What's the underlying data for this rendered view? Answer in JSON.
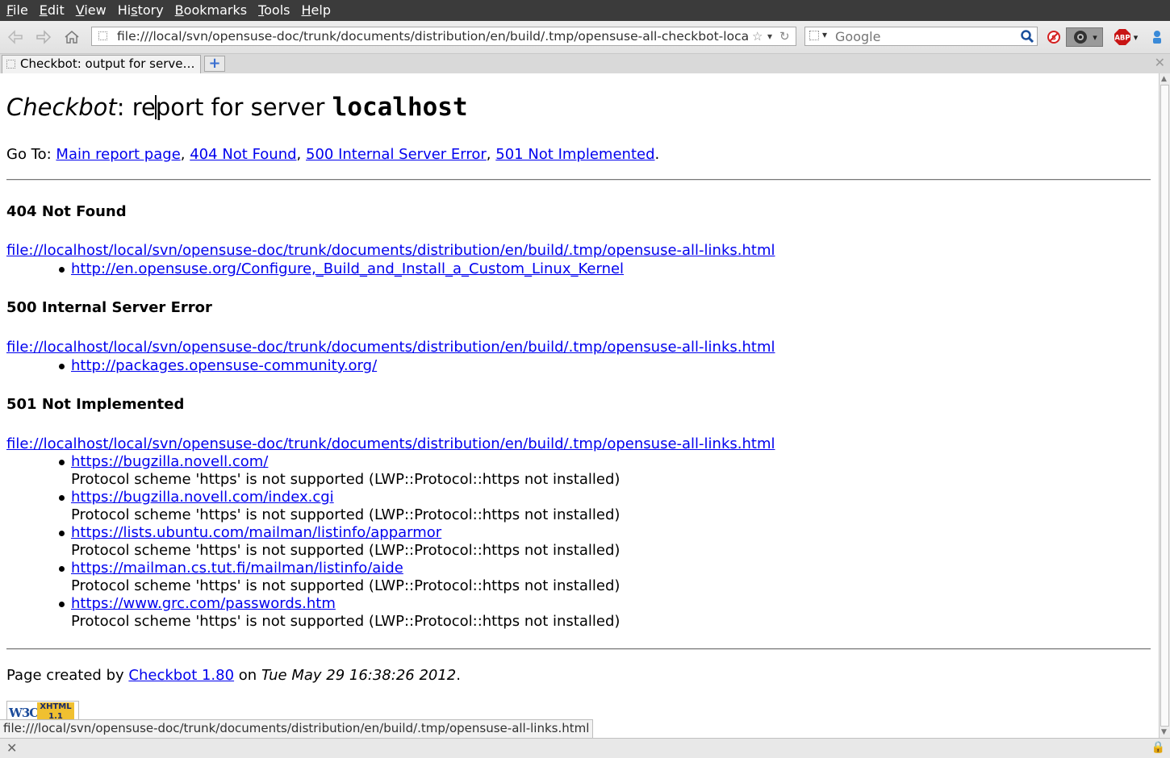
{
  "menubar": {
    "items": [
      {
        "u": "F",
        "rest": "ile"
      },
      {
        "u": "E",
        "rest": "dit"
      },
      {
        "u": "V",
        "rest": "iew"
      },
      {
        "u": "",
        "pre": "Hi",
        "u2": "s",
        "rest": "tory"
      },
      {
        "u": "B",
        "rest": "ookmarks"
      },
      {
        "u": "T",
        "rest": "ools"
      },
      {
        "u": "H",
        "rest": "elp"
      }
    ]
  },
  "navbar": {
    "url": "file:///local/svn/opensuse-doc/trunk/documents/distribution/en/build/.tmp/opensuse-all-checkbot-localhost.html",
    "search_placeholder": "Google",
    "icons": [
      "back-icon",
      "forward-icon",
      "home-icon",
      "bookmark-star-icon",
      "url-history-dropdown-icon",
      "reload-icon",
      "search-go-icon",
      "noscript-icon",
      "camera-icon",
      "adblock-plus-icon",
      "addon-person-icon"
    ],
    "abp_label": "ABP"
  },
  "tabs": [
    {
      "title": "Checkbot: output for server localhost",
      "active": true
    }
  ],
  "newtab_label": "+",
  "page": {
    "title_em": "Checkbot",
    "title_colon": ":",
    "title_part1": " re",
    "title_part2": "port for server ",
    "title_server": "localhost",
    "goto_label": "Go To: ",
    "goto_links": [
      "Main report page",
      "404 Not Found",
      "500 Internal Server Error",
      "501 Not Implemented"
    ],
    "goto_sep": ", ",
    "goto_end": ".",
    "sections": [
      {
        "heading": "404 Not Found",
        "source": "file://localhost/local/svn/opensuse-doc/trunk/documents/distribution/en/build/.tmp/opensuse-all-links.html",
        "items": [
          {
            "link": "http://en.opensuse.org/Configure,_Build_and_Install_a_Custom_Linux_Kernel",
            "msg": ""
          }
        ]
      },
      {
        "heading": "500 Internal Server Error",
        "source": "file://localhost/local/svn/opensuse-doc/trunk/documents/distribution/en/build/.tmp/opensuse-all-links.html",
        "items": [
          {
            "link": "http://packages.opensuse-community.org/",
            "msg": ""
          }
        ]
      },
      {
        "heading": "501 Not Implemented",
        "source": "file://localhost/local/svn/opensuse-doc/trunk/documents/distribution/en/build/.tmp/opensuse-all-links.html",
        "items": [
          {
            "link": "https://bugzilla.novell.com/",
            "msg": "Protocol scheme 'https' is not supported (LWP::Protocol::https not installed)"
          },
          {
            "link": "https://bugzilla.novell.com/index.cgi",
            "msg": "Protocol scheme 'https' is not supported (LWP::Protocol::https not installed)"
          },
          {
            "link": "https://lists.ubuntu.com/mailman/listinfo/apparmor",
            "msg": "Protocol scheme 'https' is not supported (LWP::Protocol::https not installed)"
          },
          {
            "link": "https://mailman.cs.tut.fi/mailman/listinfo/aide",
            "msg": "Protocol scheme 'https' is not supported (LWP::Protocol::https not installed)"
          },
          {
            "link": "https://www.grc.com/passwords.htm",
            "msg": "Protocol scheme 'https' is not supported (LWP::Protocol::https not installed)"
          }
        ]
      }
    ],
    "footer_prefix": "Page created by ",
    "footer_link": "Checkbot 1.80",
    "footer_mid": " on ",
    "footer_date": "Tue May 29 16:38:26 2012",
    "footer_end": ".",
    "badge_w3c": "W3C",
    "badge_xhtml": "XHTML",
    "badge_ver": "1.1"
  },
  "status": {
    "hover_url": "file:///local/svn/opensuse-doc/trunk/documents/distribution/en/build/.tmp/opensuse-all-links.html"
  },
  "colors": {
    "menubar_bg": "#3b3b3b",
    "link": "#0000ee",
    "newtab_plus": "#3a6fd0",
    "noscript_red": "#d42020",
    "abp_red": "#c81414"
  }
}
